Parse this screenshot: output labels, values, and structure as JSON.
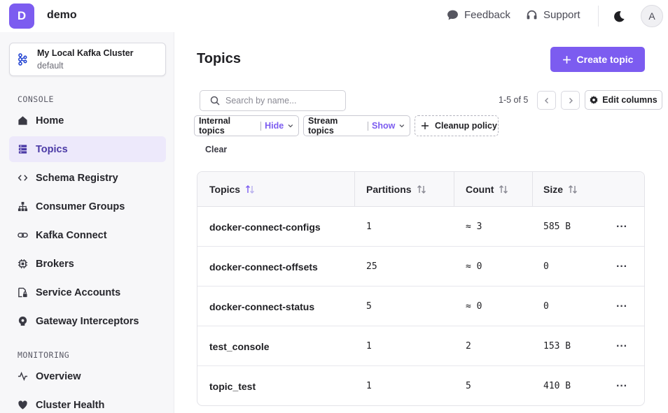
{
  "app": {
    "logo_letter": "D",
    "name": "demo"
  },
  "topbar": {
    "feedback": "Feedback",
    "support": "Support",
    "avatar_letter": "A"
  },
  "cluster": {
    "name": "My Local Kafka Cluster",
    "env": "default"
  },
  "sidebar": {
    "console_title": "CONSOLE",
    "items": [
      {
        "label": "Home",
        "icon": "home-icon"
      },
      {
        "label": "Topics",
        "icon": "topics-icon",
        "active": true
      },
      {
        "label": "Schema Registry",
        "icon": "code-icon"
      },
      {
        "label": "Consumer Groups",
        "icon": "hierarchy-icon"
      },
      {
        "label": "Kafka Connect",
        "icon": "link-icon"
      },
      {
        "label": "Brokers",
        "icon": "chip-icon"
      },
      {
        "label": "Service Accounts",
        "icon": "lock-icon"
      },
      {
        "label": "Gateway Interceptors",
        "icon": "gateway-icon"
      }
    ],
    "monitoring_title": "MONITORING",
    "monitoring_items": [
      {
        "label": "Overview",
        "icon": "pulse-icon"
      },
      {
        "label": "Cluster Health",
        "icon": "heart-icon"
      }
    ]
  },
  "main": {
    "title": "Topics",
    "create_label": "Create topic",
    "search_placeholder": "Search by name...",
    "pager_text": "1-5 of 5",
    "edit_columns": "Edit columns",
    "filters": [
      {
        "label": "Internal topics",
        "value": "Hide"
      },
      {
        "label": "Stream topics",
        "value": "Show"
      }
    ],
    "cleanup_label": "Cleanup policy",
    "clear_label": "Clear"
  },
  "table": {
    "headers": [
      "Topics",
      "Partitions",
      "Count",
      "Size"
    ],
    "rows": [
      {
        "name": "docker-connect-configs",
        "partitions": "1",
        "count": "≈ 3",
        "size": "585 B"
      },
      {
        "name": "docker-connect-offsets",
        "partitions": "25",
        "count": "≈ 0",
        "size": "0"
      },
      {
        "name": "docker-connect-status",
        "partitions": "5",
        "count": "≈ 0",
        "size": "0"
      },
      {
        "name": "test_console",
        "partitions": "1",
        "count": "2",
        "size": "153 B"
      },
      {
        "name": "topic_test",
        "partitions": "1",
        "count": "5",
        "size": "410 B"
      }
    ],
    "row_menu": "···"
  },
  "colors": {
    "accent": "#7c5cf0",
    "active_bg": "#ede9fb"
  }
}
